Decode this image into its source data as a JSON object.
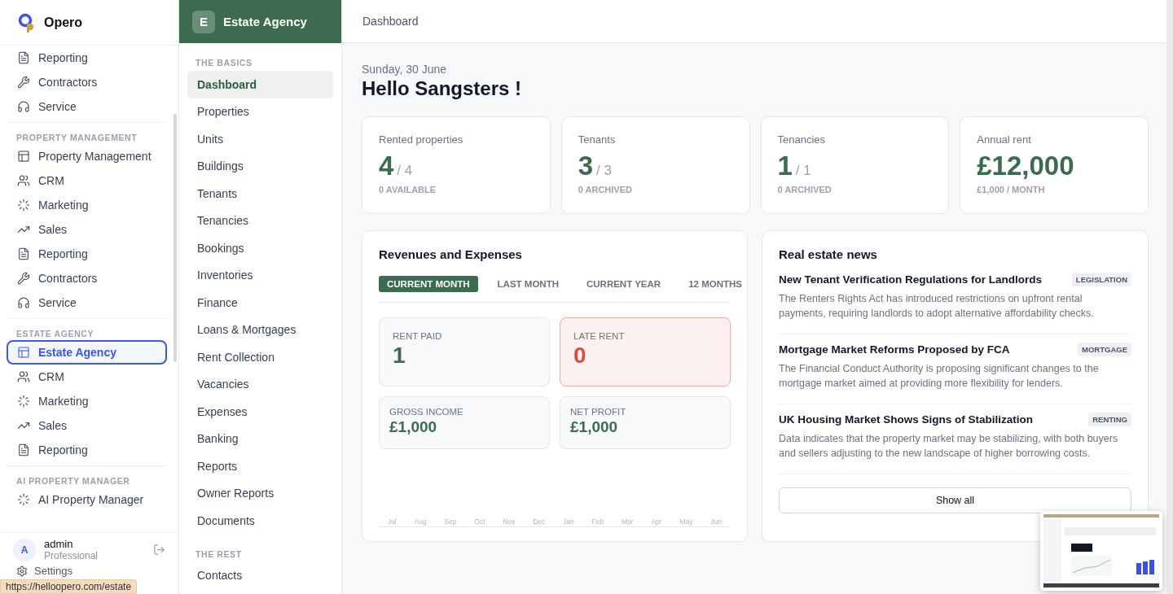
{
  "app": {
    "name": "Opero"
  },
  "sidebar": {
    "groups": [
      {
        "items": [
          {
            "label": "Reporting",
            "kind": "report",
            "selected": false
          },
          {
            "label": "Contractors",
            "kind": "tools",
            "selected": false
          },
          {
            "label": "Service",
            "kind": "headset",
            "selected": false
          }
        ]
      },
      {
        "heading": "PROPERTY MANAGEMENT",
        "items": [
          {
            "label": "Property Management",
            "kind": "layout",
            "selected": false
          },
          {
            "label": "CRM",
            "kind": "users",
            "selected": false
          },
          {
            "label": "Marketing",
            "kind": "loader",
            "selected": false
          },
          {
            "label": "Sales",
            "kind": "trend",
            "selected": false
          },
          {
            "label": "Reporting",
            "kind": "report",
            "selected": false
          },
          {
            "label": "Contractors",
            "kind": "tools",
            "selected": false
          },
          {
            "label": "Service",
            "kind": "headset",
            "selected": false
          }
        ]
      },
      {
        "heading": "ESTATE AGENCY",
        "items": [
          {
            "label": "Estate Agency",
            "kind": "layout",
            "selected": true
          },
          {
            "label": "CRM",
            "kind": "users",
            "selected": false
          },
          {
            "label": "Marketing",
            "kind": "loader",
            "selected": false
          },
          {
            "label": "Sales",
            "kind": "trend",
            "selected": false
          },
          {
            "label": "Reporting",
            "kind": "report",
            "selected": false
          }
        ]
      },
      {
        "heading": "AI PROPERTY MANAGER",
        "items": [
          {
            "label": "AI Property Manager",
            "kind": "loader",
            "selected": false
          }
        ]
      }
    ],
    "user": {
      "initial": "A",
      "name": "admin",
      "plan": "Professional"
    },
    "settings": "Settings",
    "status_url": "https://helloopero.com/estate"
  },
  "module_nav": {
    "initial": "E",
    "title": "Estate Agency",
    "sections": [
      {
        "heading": "THE BASICS",
        "items": [
          {
            "label": "Dashboard",
            "selected": true
          },
          {
            "label": "Properties",
            "selected": false
          },
          {
            "label": "Units",
            "selected": false
          },
          {
            "label": "Buildings",
            "selected": false
          },
          {
            "label": "Tenants",
            "selected": false
          },
          {
            "label": "Tenancies",
            "selected": false
          },
          {
            "label": "Bookings",
            "selected": false
          },
          {
            "label": "Inventories",
            "selected": false
          },
          {
            "label": "Finance",
            "selected": false
          },
          {
            "label": "Loans & Mortgages",
            "selected": false
          },
          {
            "label": "Rent Collection",
            "selected": false
          },
          {
            "label": "Vacancies",
            "selected": false
          },
          {
            "label": "Expenses",
            "selected": false
          },
          {
            "label": "Banking",
            "selected": false
          },
          {
            "label": "Reports",
            "selected": false
          },
          {
            "label": "Owner Reports",
            "selected": false
          },
          {
            "label": "Documents",
            "selected": false
          }
        ]
      },
      {
        "heading": "THE REST",
        "items": [
          {
            "label": "Contacts",
            "selected": false
          }
        ]
      }
    ]
  },
  "main": {
    "breadcrumb": "Dashboard",
    "date": "Sunday, 30 June",
    "greeting": "Hello Sangsters !",
    "stats": [
      {
        "label": "Rented properties",
        "value": "4",
        "total": "/ 4",
        "note": "0 AVAILABLE"
      },
      {
        "label": "Tenants",
        "value": "3",
        "total": "/ 3",
        "note": "0 ARCHIVED"
      },
      {
        "label": "Tenancies",
        "value": "1",
        "total": "/ 1",
        "note": "0 ARCHIVED"
      },
      {
        "label": "Annual rent",
        "value": "£12,000",
        "note": "£1,000 / MONTH"
      }
    ],
    "revenue": {
      "title": "Revenues and Expenses",
      "tabs": [
        {
          "label": "CURRENT MONTH",
          "selected": true
        },
        {
          "label": "LAST MONTH",
          "selected": false
        },
        {
          "label": "CURRENT YEAR",
          "selected": false
        },
        {
          "label": "12 MONTHS",
          "selected": false
        }
      ],
      "tiles": [
        {
          "label": "RENT PAID",
          "value": "1",
          "alert": false,
          "kind": "large"
        },
        {
          "label": "LATE RENT",
          "value": "0",
          "alert": true,
          "kind": "large"
        },
        {
          "label": "GROSS INCOME",
          "value": "£1,000",
          "alert": false,
          "kind": "small"
        },
        {
          "label": "NET PROFIT",
          "value": "£1,000",
          "alert": false,
          "kind": "small"
        }
      ],
      "months": [
        "Jul",
        "Aug",
        "Sep",
        "Oct",
        "Nov",
        "Dec",
        "Jan",
        "Feb",
        "Mar",
        "Apr",
        "May",
        "Jun"
      ]
    },
    "news": {
      "title": "Real estate news",
      "items": [
        {
          "title": "New Tenant Verification Regulations for Landlords",
          "tag": "LEGISLATION",
          "body": "The Renters Rights Act has introduced restrictions on upfront rental payments, requiring landlords to adopt alternative affordability checks."
        },
        {
          "title": "Mortgage Market Reforms Proposed by FCA",
          "tag": "MORTGAGE",
          "body": "The Financial Conduct Authority is proposing significant changes to the mortgage market aimed at providing more flexibility for lenders."
        },
        {
          "title": "UK Housing Market Shows Signs of Stabilization",
          "tag": "RENTING",
          "body": "Data indicates that the property market may be stabilizing, with both buyers and sellers adjusting to the new landscape of higher borrowing costs."
        }
      ],
      "button": "Show all"
    }
  }
}
